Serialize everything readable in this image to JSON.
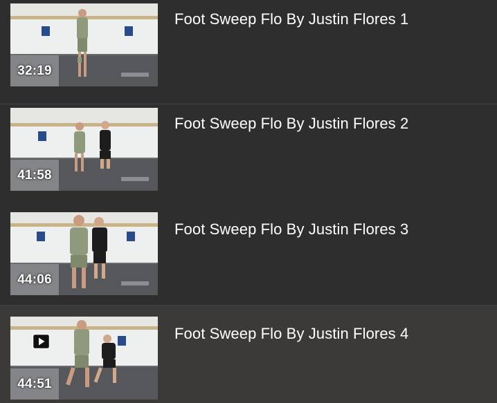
{
  "playlist": {
    "items": [
      {
        "title": "Foot Sweep Flo By Justin Flores 1",
        "duration": "32:19",
        "active": false
      },
      {
        "title": "Foot Sweep Flo By Justin Flores 2",
        "duration": "41:58",
        "active": false
      },
      {
        "title": "Foot Sweep Flo By Justin Flores 3",
        "duration": "44:06",
        "active": false
      },
      {
        "title": "Foot Sweep Flo By Justin Flores 4",
        "duration": "44:51",
        "active": true
      }
    ],
    "play_icon": "play-icon",
    "colors": {
      "background": "#2f2e2e",
      "active_row": "#3b3a39",
      "divider": "#444343",
      "title_text": "#ffffff"
    }
  }
}
